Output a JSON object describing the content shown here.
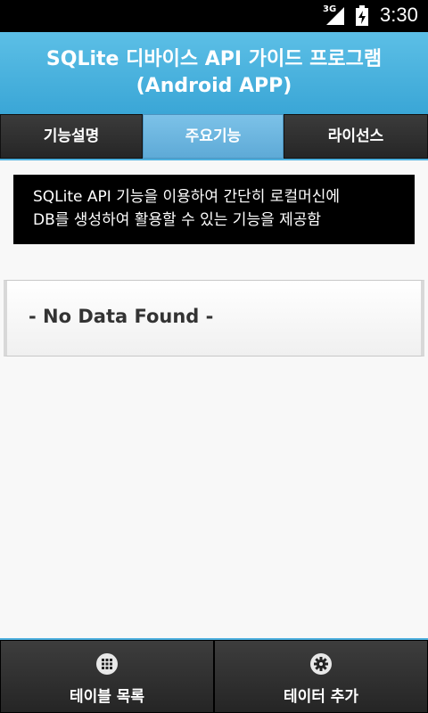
{
  "status_bar": {
    "network": "3G",
    "time": "3:30",
    "icons": [
      "signal-icon",
      "battery-charging-icon"
    ]
  },
  "title": {
    "line1": "SQLite 디바이스 API 가이드 프로그램",
    "line2": "(Android APP)"
  },
  "tabs": [
    {
      "label": "기능설명",
      "active": false
    },
    {
      "label": "주요기능",
      "active": true
    },
    {
      "label": "라이선스",
      "active": false
    }
  ],
  "description": {
    "line1": "SQLite API 기능을 이용하여 간단히 로컬머신에",
    "line2": "DB를 생성하여 활용할 수 있는 기능을 제공함"
  },
  "list": {
    "empty_text": "- No Data Found -"
  },
  "bottom_bar": {
    "buttons": [
      {
        "label": "테이블 목록",
        "icon": "grid-icon"
      },
      {
        "label": "테이터 추가",
        "icon": "gear-icon"
      }
    ]
  },
  "colors": {
    "accent": "#4db0de",
    "title_bg": "#48b2de",
    "active_tab": "#6cb6e0"
  }
}
